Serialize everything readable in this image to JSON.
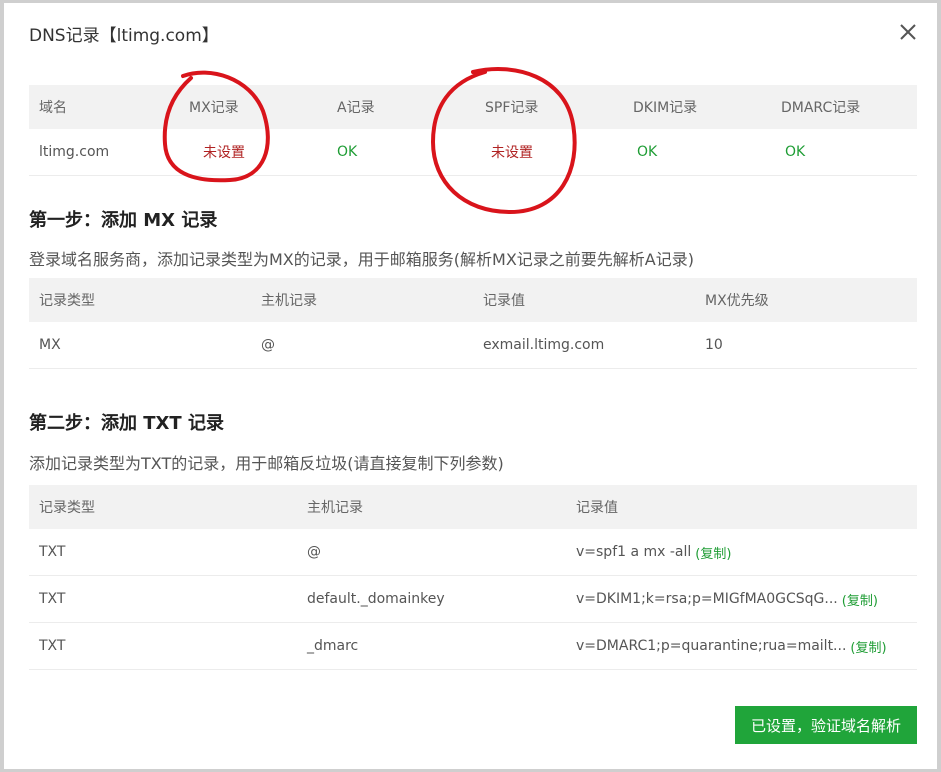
{
  "dialog": {
    "title": "DNS记录【ltimg.com】",
    "close_icon": "close-icon"
  },
  "summary": {
    "headers": [
      "域名",
      "MX记录",
      "A记录",
      "SPF记录",
      "DKIM记录",
      "DMARC记录"
    ],
    "row": {
      "domain": "ltimg.com",
      "mx": "未设置",
      "a": "OK",
      "spf": "未设置",
      "dkim": "OK",
      "dmarc": "OK"
    }
  },
  "step1": {
    "title": "第一步：添加 MX 记录",
    "desc": "登录域名服务商，添加记录类型为MX的记录，用于邮箱服务(解析MX记录之前要先解析A记录)",
    "headers": [
      "记录类型",
      "主机记录",
      "记录值",
      "MX优先级"
    ],
    "rows": [
      {
        "type": "MX",
        "host": "@",
        "value": "exmail.ltimg.com",
        "priority": "10"
      }
    ]
  },
  "step2": {
    "title": "第二步：添加 TXT 记录",
    "desc": "添加记录类型为TXT的记录，用于邮箱反垃圾(请直接复制下列参数)",
    "headers": [
      "记录类型",
      "主机记录",
      "记录值"
    ],
    "rows": [
      {
        "type": "TXT",
        "host": "@",
        "value": "v=spf1 a mx -all",
        "copy": "(复制)"
      },
      {
        "type": "TXT",
        "host": "default._domainkey",
        "value": "v=DKIM1;k=rsa;p=MIGfMA0GCSqG...",
        "copy": "(复制)"
      },
      {
        "type": "TXT",
        "host": "_dmarc",
        "value": "v=DMARC1;p=quarantine;rua=mailt...",
        "copy": "(复制)"
      }
    ]
  },
  "footer": {
    "verify_label": "已设置，验证域名解析"
  },
  "colors": {
    "accent": "#20a53a",
    "ok": "#1f9d35",
    "bad": "#b02222",
    "annotation": "#d9141b"
  }
}
